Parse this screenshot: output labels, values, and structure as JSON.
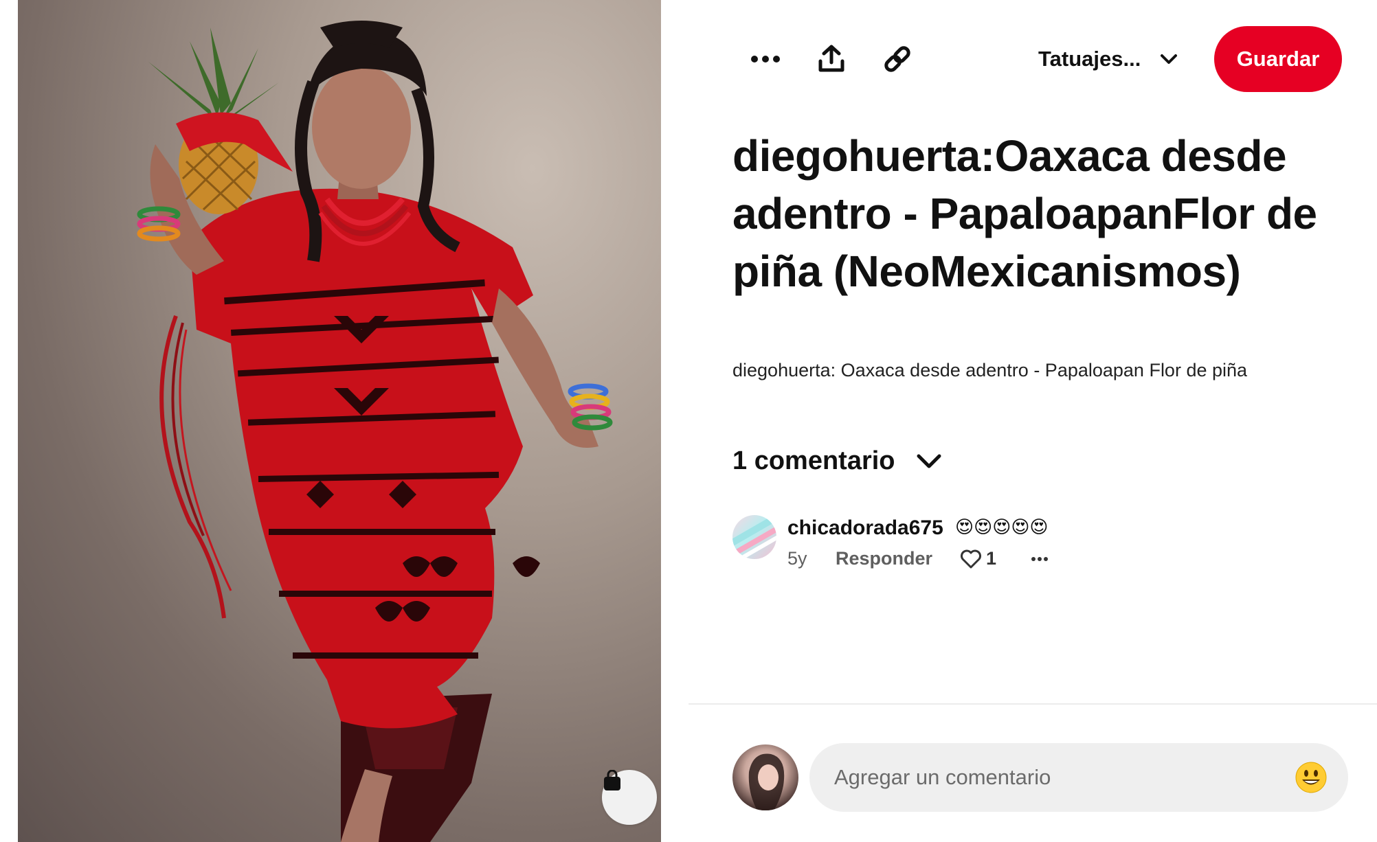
{
  "topbar": {
    "more_icon": "more-horizontal-icon",
    "share_icon": "share-upload-icon",
    "link_icon": "link-icon",
    "board_label": "Tatuajes...",
    "board_chevron_icon": "chevron-down-icon",
    "save_label": "Guardar",
    "accent_color": "#e60023"
  },
  "pin": {
    "title": "diegohuerta:Oaxaca desde adentro - PapaloapanFlor de piña (NeoMexicanismos)",
    "description": "diegohuerta: Oaxaca desde adentro - Papaloapan Flor de piña",
    "shop_icon": "shopping-bag-icon"
  },
  "comments": {
    "toggle_label": "1 comentario",
    "toggle_icon": "chevron-down-icon",
    "items": [
      {
        "username": "chicadorada675",
        "text": "😍😍😍😍😍",
        "age": "5y",
        "reply_label": "Responder",
        "likes": "1",
        "like_icon": "heart-outline-icon",
        "more_icon": "more-horizontal-icon"
      }
    ]
  },
  "add_comment": {
    "placeholder": "Agregar un comentario",
    "emoji_icon": "smiley-emoji-icon"
  }
}
